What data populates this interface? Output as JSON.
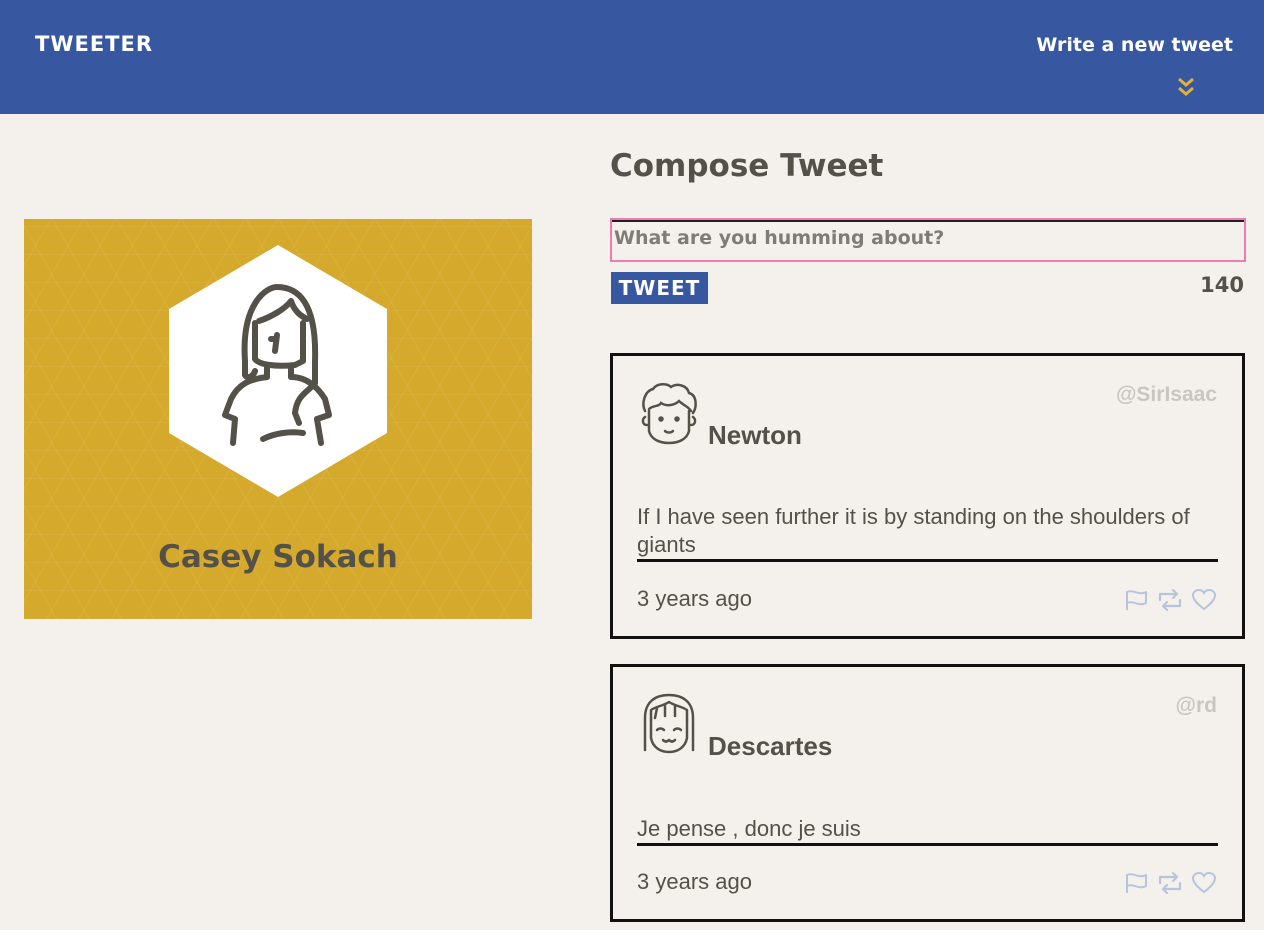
{
  "header": {
    "brand": "TWEETER",
    "write_link": "Write a new tweet"
  },
  "profile": {
    "name": "Casey Sokach"
  },
  "compose": {
    "title": "Compose Tweet",
    "placeholder": "What are you humming about?",
    "button_label": "TWEET",
    "counter": "140"
  },
  "tweets": [
    {
      "author": "Newton",
      "handle": "@SirIsaac",
      "content": "If I have seen further it is by standing on the shoulders of giants",
      "time": "3 years ago"
    },
    {
      "author": "Descartes",
      "handle": "@rd",
      "content": "Je pense , donc je suis",
      "time": "3 years ago"
    }
  ],
  "colors": {
    "nav": "#3757a0",
    "accent": "#d5a92b",
    "background": "#f4f1ec",
    "text": "#545149"
  }
}
